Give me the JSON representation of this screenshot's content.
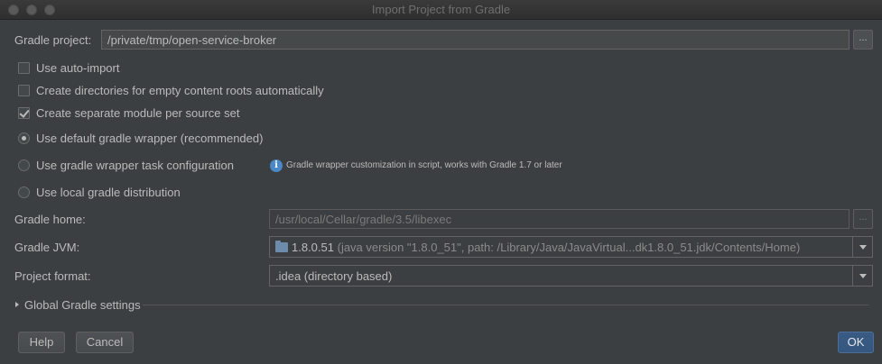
{
  "window": {
    "title": "Import Project from Gradle"
  },
  "gradle_project": {
    "label": "Gradle project:",
    "value": "/private/tmp/open-service-broker",
    "browse_label": "..."
  },
  "options": {
    "auto_import": {
      "label": "Use auto-import",
      "checked": false
    },
    "create_dirs": {
      "label": "Create directories for empty content roots automatically",
      "checked": false
    },
    "separate_module": {
      "label": "Create separate module per source set",
      "checked": true
    }
  },
  "distribution": {
    "default_wrapper": {
      "label": "Use default gradle wrapper (recommended)",
      "selected": true
    },
    "wrapper_task": {
      "label": "Use gradle wrapper task configuration",
      "selected": false
    },
    "local": {
      "label": "Use local gradle distribution",
      "selected": false
    },
    "info_hint": "Gradle wrapper customization in script, works with Gradle 1.7 or later"
  },
  "gradle_home": {
    "label": "Gradle home:",
    "value": "/usr/local/Cellar/gradle/3.5/libexec",
    "browse_label": "..."
  },
  "gradle_jvm": {
    "label": "Gradle JVM:",
    "version": "1.8.0.51",
    "detail": " (java version \"1.8.0_51\", path: /Library/Java/JavaVirtual...dk1.8.0_51.jdk/Contents/Home)"
  },
  "project_format": {
    "label": "Project format:",
    "value": ".idea (directory based)"
  },
  "global_settings": {
    "label": "Global Gradle settings",
    "expanded": false
  },
  "buttons": {
    "help": "Help",
    "cancel": "Cancel",
    "ok": "OK"
  },
  "colors": {
    "background": "#3c3f41",
    "accent": "#365880",
    "text": "#bbbbbb",
    "info": "#4a88c7"
  },
  "icons": {
    "info": "info-icon",
    "folder": "jdk-folder-icon",
    "dropdown": "chevron-down-icon",
    "expander": "triangle-right-icon"
  }
}
